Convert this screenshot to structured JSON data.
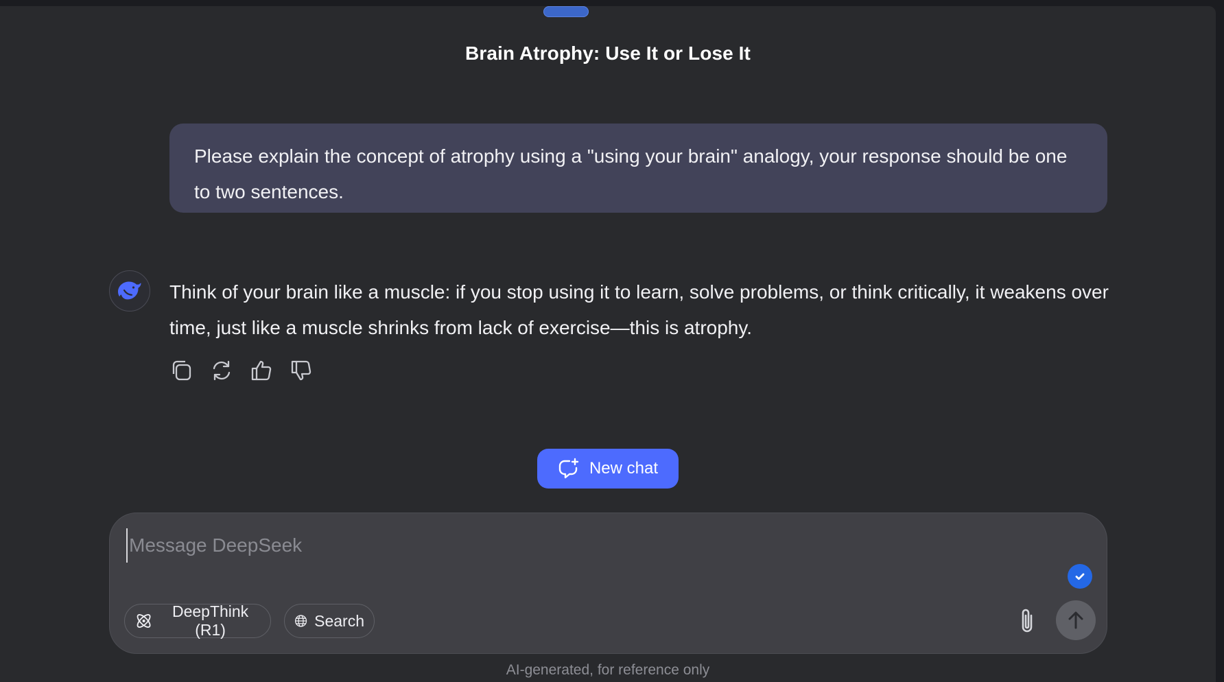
{
  "conversation": {
    "title": "Brain Atrophy: Use It or Lose It"
  },
  "messages": {
    "user": "Please explain the concept of atrophy using a \"using your brain\" analogy, your response should be one to two sentences.",
    "assistant": "Think of your brain like a muscle: if you stop using it to learn, solve problems, or think critically, it weakens over time, just like a muscle shrinks from lack of exercise—this is atrophy."
  },
  "assistant_actions": [
    {
      "name": "copy",
      "icon": "copy-icon"
    },
    {
      "name": "regenerate",
      "icon": "refresh-icon"
    },
    {
      "name": "like",
      "icon": "thumbs-up-icon"
    },
    {
      "name": "dislike",
      "icon": "thumbs-down-icon"
    }
  ],
  "new_chat": {
    "label": "New chat",
    "icon": "new-chat-icon"
  },
  "composer": {
    "placeholder": "Message DeepSeek",
    "value": "",
    "deepthink_label": "DeepThink (R1)",
    "search_label": "Search",
    "attach_icon": "paperclip-icon",
    "send_icon": "arrow-up-icon"
  },
  "footer": {
    "disclaimer": "AI-generated, for reference only"
  },
  "colors": {
    "background": "#292a2d",
    "user_bubble": "#424359",
    "accent": "#4d6bfe",
    "composer": "#404045"
  }
}
